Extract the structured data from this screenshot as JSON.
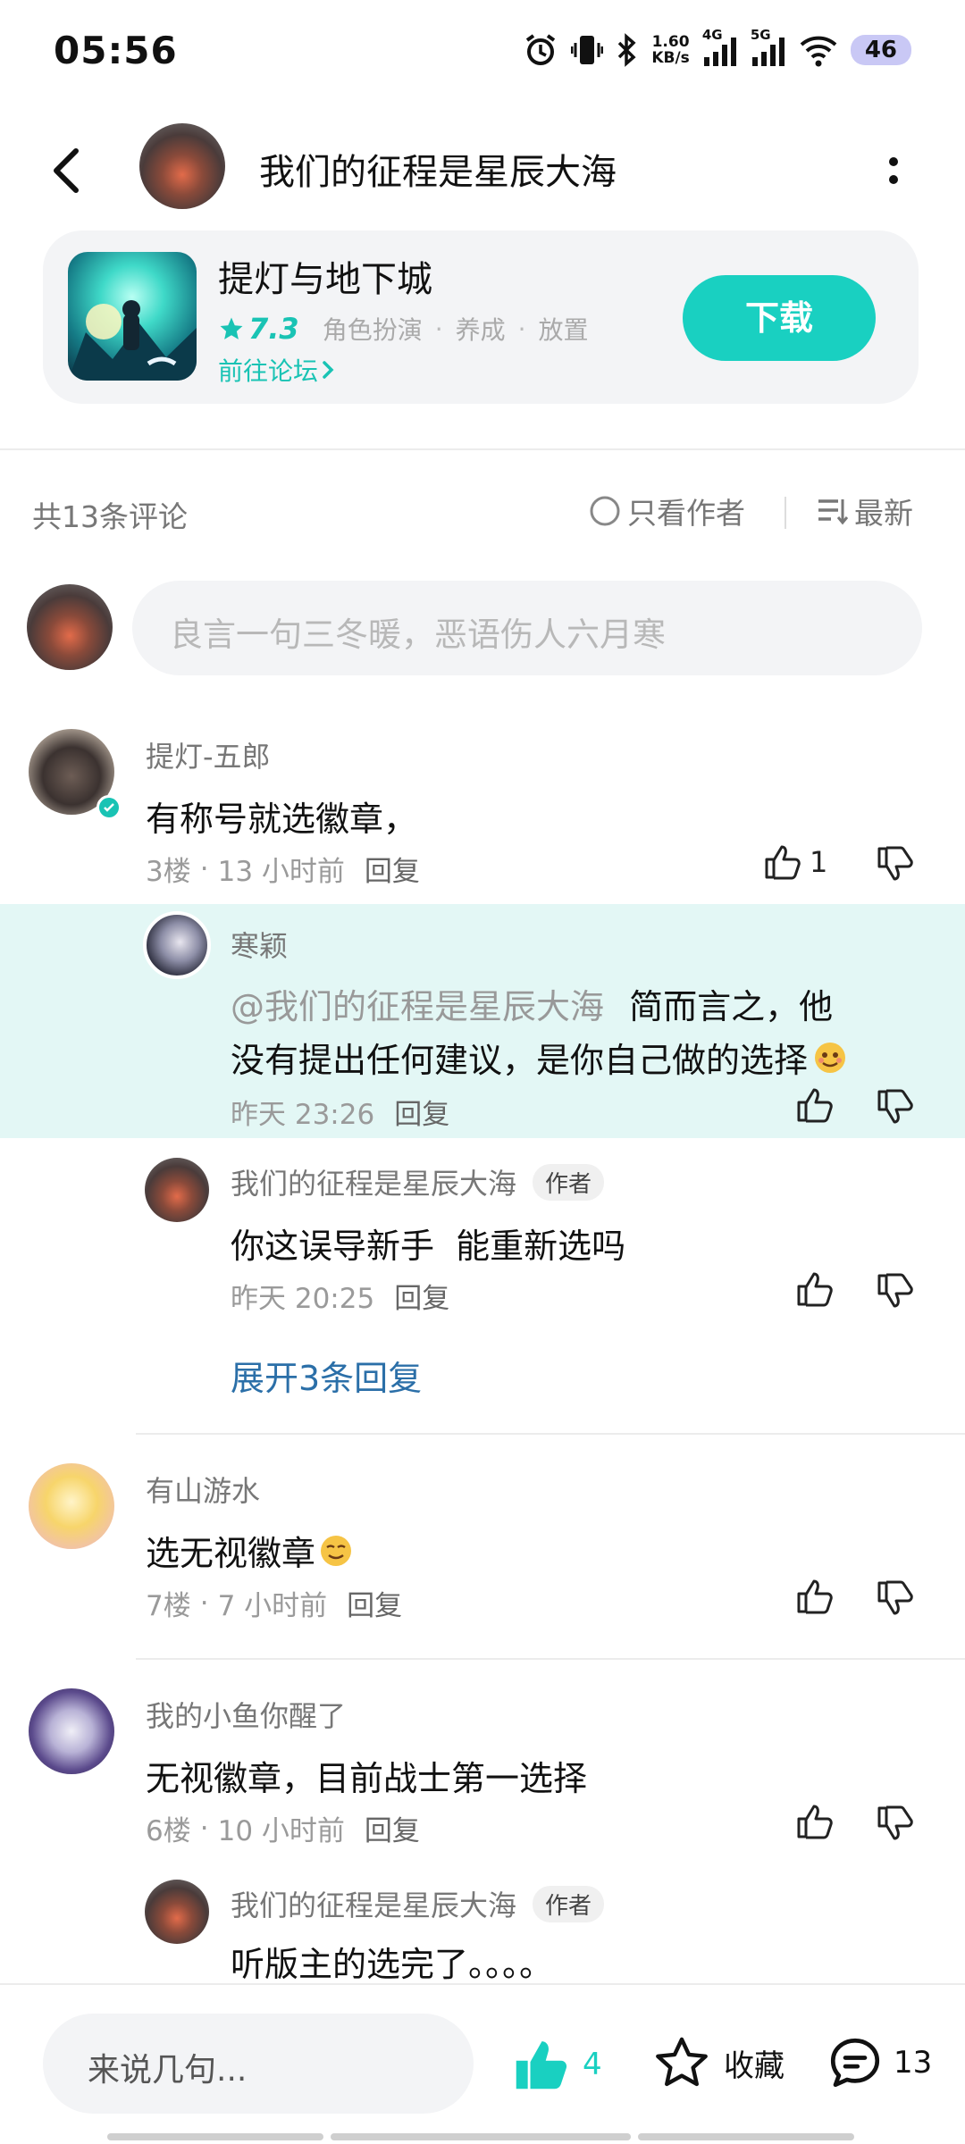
{
  "status_bar": {
    "time": "05:56",
    "net_speed_top": "1.60",
    "net_speed_bottom": "KB/s",
    "sig1_label": "4G",
    "sig2_label": "5G",
    "battery": "46"
  },
  "header": {
    "title": "我们的征程是星辰大海"
  },
  "game": {
    "name": "提灯与地下城",
    "rating": "7.3",
    "tags": [
      "角色扮演",
      "养成",
      "放置"
    ],
    "forum_link": "前往论坛",
    "download_label": "下载"
  },
  "comments_bar": {
    "count_text": "共13条评论",
    "author_only": "只看作者",
    "sort": "最新"
  },
  "composer": {
    "placeholder": "良言一句三冬暖，恶语伤人六月寒"
  },
  "comments": [
    {
      "name": "提灯-五郎",
      "text": "有称号就选徽章，",
      "floor": "3楼",
      "time": "13 小时前",
      "reply": "回复",
      "likes": "1"
    },
    {
      "name": "有山游水",
      "text": "选无视徽章",
      "floor": "7楼",
      "time": "7 小时前",
      "reply": "回复"
    },
    {
      "name": "我的小鱼你醒了",
      "text": "无视徽章，目前战士第一选择",
      "floor": "6楼",
      "time": "10 小时前",
      "reply": "回复"
    }
  ],
  "replies": [
    {
      "name": "寒颖",
      "mention": "@我们的征程是星辰大海",
      "text_line1": "简而言之，他",
      "text_line2": "没有提出任何建议，是你自己做的选择",
      "time": "昨天 23:26",
      "reply": "回复"
    },
    {
      "name": "我们的征程是星辰大海",
      "badge": "作者",
      "text": "你这误导新手  能重新选吗",
      "time": "昨天 20:25",
      "reply": "回复"
    },
    {
      "name": "我们的征程是星辰大海",
      "badge": "作者",
      "text": "听版主的选完了。。。。"
    }
  ],
  "expand_replies": "展开3条回复",
  "bottom_bar": {
    "input_placeholder": "来说几句...",
    "likes": "4",
    "favorite": "收藏",
    "comments": "13"
  },
  "colors": {
    "accent": "#19d0c1",
    "highlight_bg": "#e3f7f5",
    "link_blue": "#2b6fa8",
    "rating": "#19c3b4"
  }
}
